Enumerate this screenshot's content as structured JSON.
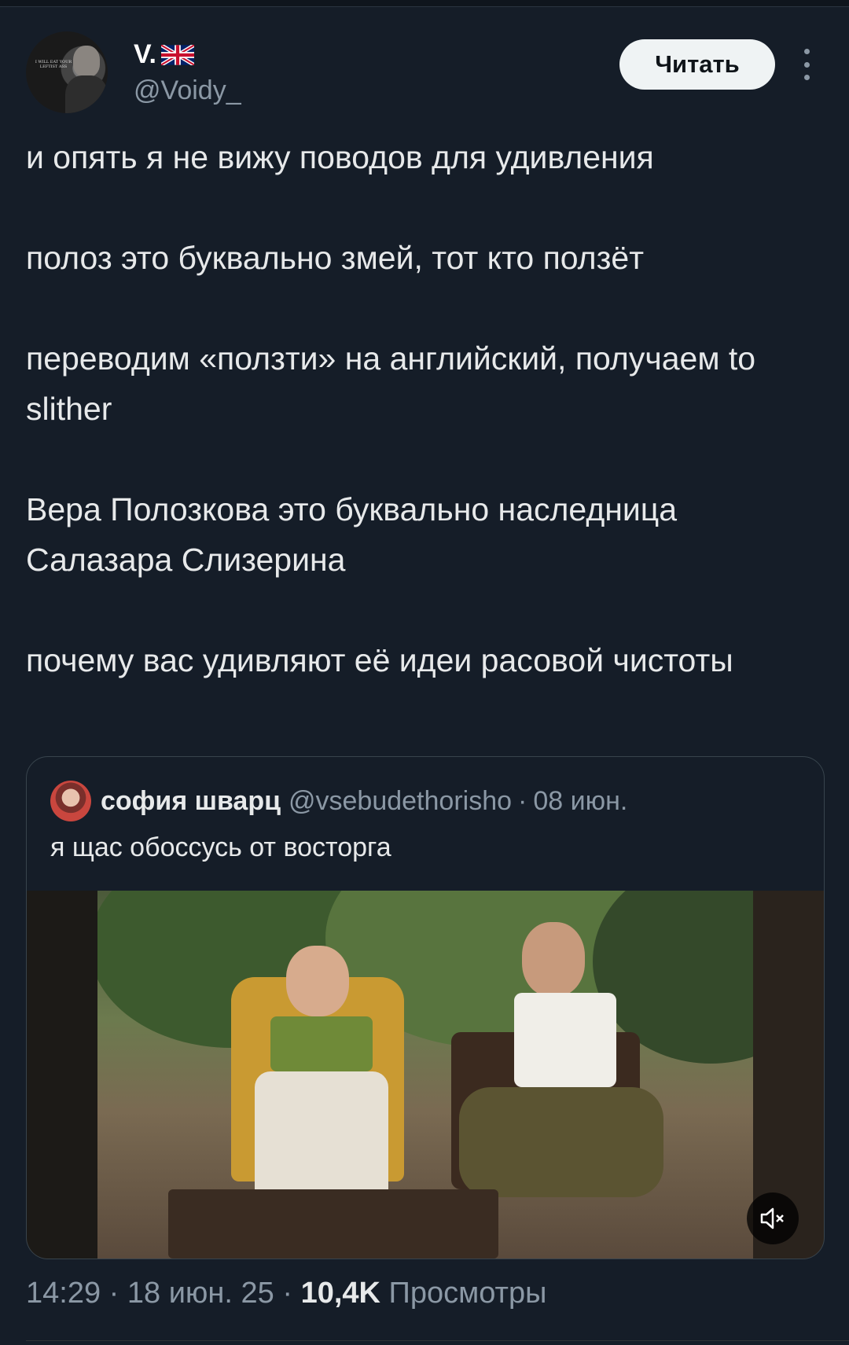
{
  "author": {
    "name": "V.",
    "flag_icon": "uk-flag-icon",
    "handle": "@Voidy_",
    "avatar_caption": "I WILL EAT YOUR LEFTIST ASS"
  },
  "actions": {
    "follow_label": "Читать",
    "more_icon": "more-vertical-icon"
  },
  "tweet": {
    "paragraphs": [
      "и опять я не вижу поводов для удивления",
      "полоз это буквально змей, тот кто ползёт",
      "переводим «ползти» на английский, получаем to slither",
      "Вера Полозкова это буквально наследница Салазара Слизерина",
      "почему вас удивляют её идеи расовой чистоты"
    ]
  },
  "quote": {
    "name": "софия шварц",
    "handle": "@vsebudethorisho",
    "separator": "·",
    "date": "08 июн.",
    "text": "я щас обоссусь от восторга",
    "media": {
      "type": "video",
      "sound_icon": "muted-speaker-icon"
    }
  },
  "footer": {
    "time": "14:29",
    "sep": "·",
    "date": "18 июн. 25",
    "views_count": "10,4K",
    "views_label": "Просмотры"
  },
  "colors": {
    "background": "#151d28",
    "text": "#e7e9ea",
    "muted": "#8b98a5",
    "border": "#38444d"
  }
}
